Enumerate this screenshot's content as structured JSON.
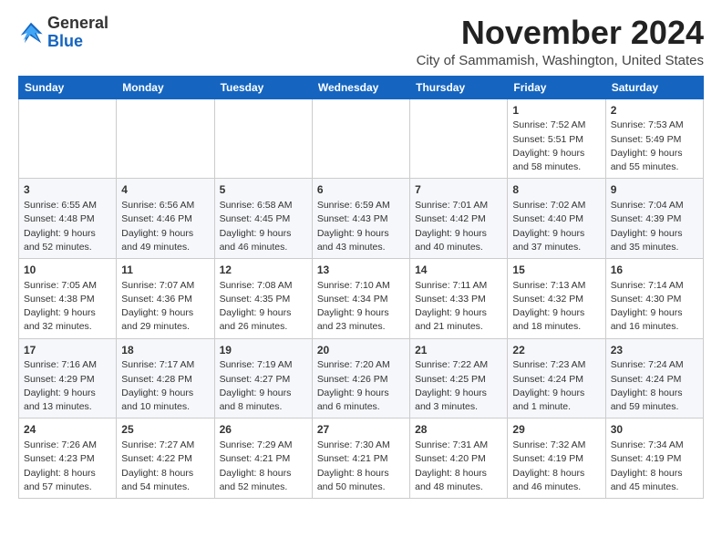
{
  "header": {
    "logo_general": "General",
    "logo_blue": "Blue",
    "month_title": "November 2024",
    "location": "City of Sammamish, Washington, United States"
  },
  "days_of_week": [
    "Sunday",
    "Monday",
    "Tuesday",
    "Wednesday",
    "Thursday",
    "Friday",
    "Saturday"
  ],
  "weeks": [
    [
      {
        "day": "",
        "info": ""
      },
      {
        "day": "",
        "info": ""
      },
      {
        "day": "",
        "info": ""
      },
      {
        "day": "",
        "info": ""
      },
      {
        "day": "",
        "info": ""
      },
      {
        "day": "1",
        "info": "Sunrise: 7:52 AM\nSunset: 5:51 PM\nDaylight: 9 hours and 58 minutes."
      },
      {
        "day": "2",
        "info": "Sunrise: 7:53 AM\nSunset: 5:49 PM\nDaylight: 9 hours and 55 minutes."
      }
    ],
    [
      {
        "day": "3",
        "info": "Sunrise: 6:55 AM\nSunset: 4:48 PM\nDaylight: 9 hours and 52 minutes."
      },
      {
        "day": "4",
        "info": "Sunrise: 6:56 AM\nSunset: 4:46 PM\nDaylight: 9 hours and 49 minutes."
      },
      {
        "day": "5",
        "info": "Sunrise: 6:58 AM\nSunset: 4:45 PM\nDaylight: 9 hours and 46 minutes."
      },
      {
        "day": "6",
        "info": "Sunrise: 6:59 AM\nSunset: 4:43 PM\nDaylight: 9 hours and 43 minutes."
      },
      {
        "day": "7",
        "info": "Sunrise: 7:01 AM\nSunset: 4:42 PM\nDaylight: 9 hours and 40 minutes."
      },
      {
        "day": "8",
        "info": "Sunrise: 7:02 AM\nSunset: 4:40 PM\nDaylight: 9 hours and 37 minutes."
      },
      {
        "day": "9",
        "info": "Sunrise: 7:04 AM\nSunset: 4:39 PM\nDaylight: 9 hours and 35 minutes."
      }
    ],
    [
      {
        "day": "10",
        "info": "Sunrise: 7:05 AM\nSunset: 4:38 PM\nDaylight: 9 hours and 32 minutes."
      },
      {
        "day": "11",
        "info": "Sunrise: 7:07 AM\nSunset: 4:36 PM\nDaylight: 9 hours and 29 minutes."
      },
      {
        "day": "12",
        "info": "Sunrise: 7:08 AM\nSunset: 4:35 PM\nDaylight: 9 hours and 26 minutes."
      },
      {
        "day": "13",
        "info": "Sunrise: 7:10 AM\nSunset: 4:34 PM\nDaylight: 9 hours and 23 minutes."
      },
      {
        "day": "14",
        "info": "Sunrise: 7:11 AM\nSunset: 4:33 PM\nDaylight: 9 hours and 21 minutes."
      },
      {
        "day": "15",
        "info": "Sunrise: 7:13 AM\nSunset: 4:32 PM\nDaylight: 9 hours and 18 minutes."
      },
      {
        "day": "16",
        "info": "Sunrise: 7:14 AM\nSunset: 4:30 PM\nDaylight: 9 hours and 16 minutes."
      }
    ],
    [
      {
        "day": "17",
        "info": "Sunrise: 7:16 AM\nSunset: 4:29 PM\nDaylight: 9 hours and 13 minutes."
      },
      {
        "day": "18",
        "info": "Sunrise: 7:17 AM\nSunset: 4:28 PM\nDaylight: 9 hours and 10 minutes."
      },
      {
        "day": "19",
        "info": "Sunrise: 7:19 AM\nSunset: 4:27 PM\nDaylight: 9 hours and 8 minutes."
      },
      {
        "day": "20",
        "info": "Sunrise: 7:20 AM\nSunset: 4:26 PM\nDaylight: 9 hours and 6 minutes."
      },
      {
        "day": "21",
        "info": "Sunrise: 7:22 AM\nSunset: 4:25 PM\nDaylight: 9 hours and 3 minutes."
      },
      {
        "day": "22",
        "info": "Sunrise: 7:23 AM\nSunset: 4:24 PM\nDaylight: 9 hours and 1 minute."
      },
      {
        "day": "23",
        "info": "Sunrise: 7:24 AM\nSunset: 4:24 PM\nDaylight: 8 hours and 59 minutes."
      }
    ],
    [
      {
        "day": "24",
        "info": "Sunrise: 7:26 AM\nSunset: 4:23 PM\nDaylight: 8 hours and 57 minutes."
      },
      {
        "day": "25",
        "info": "Sunrise: 7:27 AM\nSunset: 4:22 PM\nDaylight: 8 hours and 54 minutes."
      },
      {
        "day": "26",
        "info": "Sunrise: 7:29 AM\nSunset: 4:21 PM\nDaylight: 8 hours and 52 minutes."
      },
      {
        "day": "27",
        "info": "Sunrise: 7:30 AM\nSunset: 4:21 PM\nDaylight: 8 hours and 50 minutes."
      },
      {
        "day": "28",
        "info": "Sunrise: 7:31 AM\nSunset: 4:20 PM\nDaylight: 8 hours and 48 minutes."
      },
      {
        "day": "29",
        "info": "Sunrise: 7:32 AM\nSunset: 4:19 PM\nDaylight: 8 hours and 46 minutes."
      },
      {
        "day": "30",
        "info": "Sunrise: 7:34 AM\nSunset: 4:19 PM\nDaylight: 8 hours and 45 minutes."
      }
    ]
  ]
}
